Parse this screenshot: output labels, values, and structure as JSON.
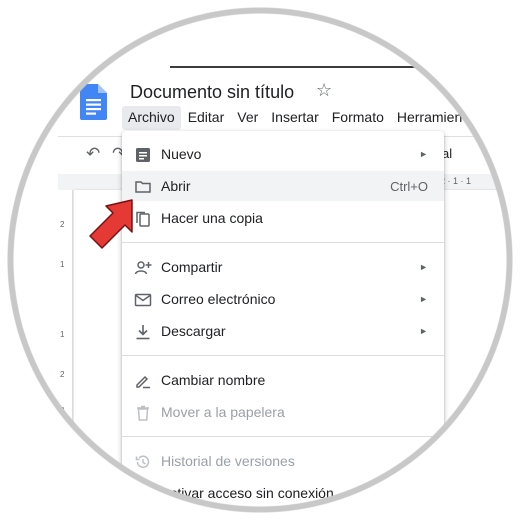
{
  "doc": {
    "title": "Documento sin título",
    "star_icon": "star-icon",
    "font_fragment": "al"
  },
  "menubar": {
    "items": [
      "Archivo",
      "Editar",
      "Ver",
      "Insertar",
      "Formato",
      "Herramien"
    ]
  },
  "ruler": {
    "vertical_ticks": [
      "2",
      "1",
      "1",
      "2",
      "3"
    ],
    "horizontal_fragment": "2 · 1 · 1"
  },
  "file_menu": {
    "items": [
      {
        "label": "Nuevo",
        "icon": "new-doc-icon",
        "submenu": true
      },
      {
        "label": "Abrir",
        "icon": "folder-icon",
        "shortcut": "Ctrl+O"
      },
      {
        "label": "Hacer una copia",
        "icon": "copy-icon"
      },
      {
        "label": "Compartir",
        "icon": "person-add-icon",
        "submenu": true
      },
      {
        "label": "Correo electrónico",
        "icon": "mail-icon",
        "submenu": true
      },
      {
        "label": "Descargar",
        "icon": "download-icon",
        "submenu": true
      },
      {
        "label": "Cambiar nombre",
        "icon": "rename-icon"
      },
      {
        "label": "Mover a la papelera",
        "icon": "trash-icon",
        "disabled": true
      },
      {
        "label": "Historial de versiones",
        "icon": "history-icon",
        "disabled": true
      },
      {
        "label": "Activar acceso sin conexión",
        "icon": ""
      }
    ],
    "submenu_glyph": "►"
  },
  "colors": {
    "docs_blue": "#4285f4",
    "cursor_red": "#e53935",
    "menu_hover": "#f1f3f4"
  }
}
